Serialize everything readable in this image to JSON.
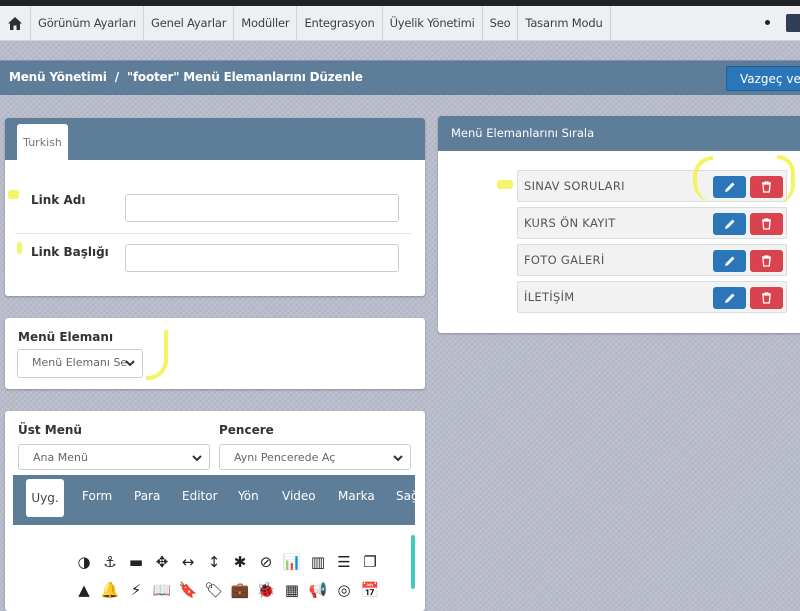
{
  "nav": {
    "home_icon": "home-icon",
    "items": [
      "Görünüm Ayarları",
      "Genel Ayarlar",
      "Modüller",
      "Entegrasyon",
      "Üyelik Yönetimi",
      "Seo",
      "Tasarım Modu"
    ]
  },
  "header": {
    "breadcrumb_root": "Menü Yönetimi",
    "breadcrumb_sep": "/",
    "breadcrumb_current": "\"footer\" Menü Elemanlarını Düzenle",
    "cancel_label": "Vazgeç ve L"
  },
  "form": {
    "language_tab": "Turkish",
    "link_name_label": "Link Adı",
    "link_name_value": "",
    "link_title_label": "Link Başlığı",
    "link_title_value": ""
  },
  "menu_element": {
    "label": "Menü Elemanı",
    "select_value": "Menü Elemanı Se"
  },
  "options": {
    "parent_label": "Üst Menü",
    "parent_value": "Ana Menü",
    "window_label": "Pencere",
    "window_value": "Aynı Pencerede Aç",
    "tabs": [
      "Uyg.",
      "Form",
      "Para",
      "Editor",
      "Yön",
      "Video",
      "Marka",
      "Sağ"
    ],
    "icon_row_1": [
      "◑",
      "⚓",
      "▬",
      "✥",
      "↔",
      "↕",
      "✱",
      "⊘",
      "📊",
      "▥",
      "☰",
      "❐"
    ],
    "icon_row_2": [
      "▲",
      "🔔",
      "⚡",
      "📖",
      "🔖",
      "🏷",
      "💼",
      "🐞",
      "▦",
      "📢",
      "◎",
      "📅"
    ]
  },
  "sort_panel": {
    "title": "Menü Elemanlarını Sırala",
    "items": [
      "SINAV SORULARI",
      "KURS ÖN KAYIT",
      "FOTO GALERİ",
      "İLETİŞİM"
    ]
  },
  "colors": {
    "primary": "#2a76b9",
    "danger": "#d9434e",
    "header": "#5e7d98",
    "highlight": "#f1f23a"
  }
}
